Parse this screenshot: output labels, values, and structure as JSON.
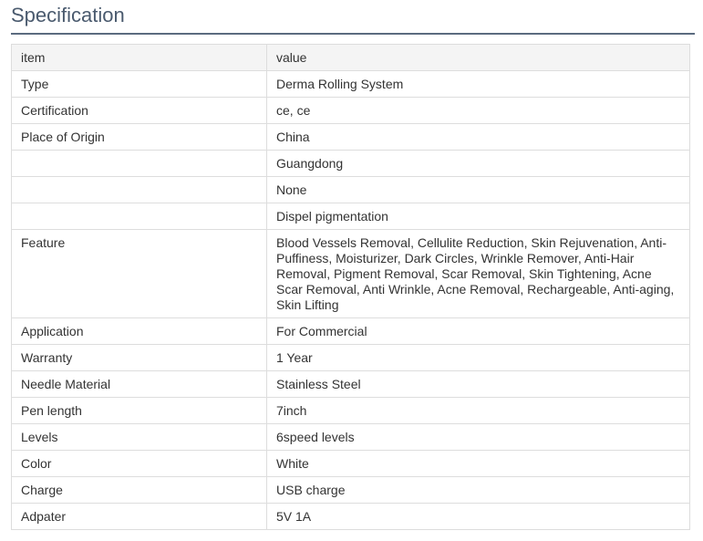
{
  "section": {
    "title": "Specification"
  },
  "table": {
    "header": {
      "item": "item",
      "value": "value"
    },
    "rows": [
      {
        "item": "Type",
        "value": "Derma Rolling System"
      },
      {
        "item": "Certification",
        "value": "ce, ce"
      },
      {
        "item": "Place of Origin",
        "value": "China"
      },
      {
        "item": "",
        "value": "Guangdong"
      },
      {
        "item": "",
        "value": "None"
      },
      {
        "item": "",
        "value": "Dispel pigmentation"
      },
      {
        "item": "Feature",
        "value": "Blood Vessels Removal, Cellulite Reduction, Skin Rejuvenation, Anti-Puffiness, Moisturizer, Dark Circles, Wrinkle Remover, Anti-Hair Removal, Pigment Removal, Scar Removal, Skin Tightening, Acne Scar Removal, Anti Wrinkle, Acne Removal, Rechargeable, Anti-aging, Skin Lifting"
      },
      {
        "item": "Application",
        "value": "For Commercial"
      },
      {
        "item": "Warranty",
        "value": "1 Year"
      },
      {
        "item": "Needle Material",
        "value": "Stainless Steel"
      },
      {
        "item": "Pen length",
        "value": "7inch"
      },
      {
        "item": "Levels",
        "value": "6speed levels"
      },
      {
        "item": "Color",
        "value": "White"
      },
      {
        "item": "Charge",
        "value": "USB charge"
      },
      {
        "item": "Adpater",
        "value": "5V 1A"
      }
    ]
  }
}
